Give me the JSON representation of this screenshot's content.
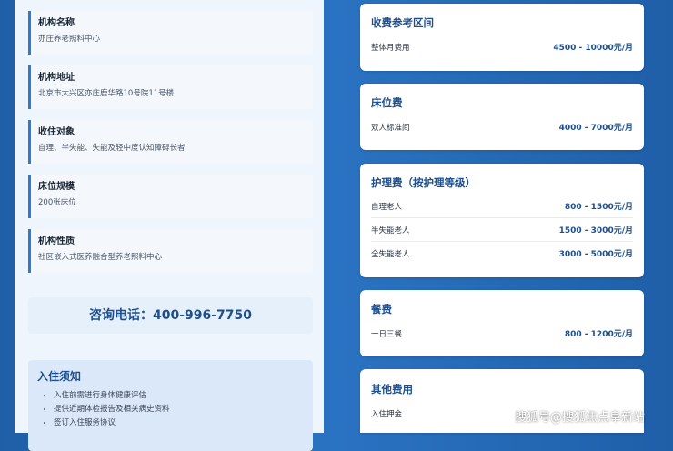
{
  "info_items": [
    {
      "title": "机构名称",
      "value": "亦庄养老照料中心"
    },
    {
      "title": "机构地址",
      "value": "北京市大兴区亦庄鹿华路10号院11号楼"
    },
    {
      "title": "收住对象",
      "value": "自理、半失能、失能及轻中度认知障碍长者"
    },
    {
      "title": "床位规模",
      "value": "200张床位"
    },
    {
      "title": "机构性质",
      "value": "社区嵌入式医养融合型养老照料中心"
    }
  ],
  "phone": "咨询电话：400-996-7750",
  "notice": {
    "title": "入住须知",
    "items": [
      "入住前需进行身体健康评估",
      "提供近期体检报告及相关病史资料",
      "签订入住服务协议"
    ]
  },
  "cards": [
    {
      "title": "收费参考区间",
      "rows": [
        {
          "label": "整体月费用",
          "price": "4500 - 10000元/月"
        }
      ]
    },
    {
      "title": "床位费",
      "rows": [
        {
          "label": "双人标准间",
          "price": "4000 - 7000元/月"
        }
      ]
    },
    {
      "title": "护理费（按护理等级）",
      "rows": [
        {
          "label": "自理老人",
          "price": "800 - 1500元/月"
        },
        {
          "label": "半失能老人",
          "price": "1500 - 3000元/月"
        },
        {
          "label": "全失能老人",
          "price": "3000 - 5000元/月"
        }
      ]
    },
    {
      "title": "餐费",
      "rows": [
        {
          "label": "一日三餐",
          "price": "800 - 1200元/月"
        }
      ]
    },
    {
      "title": "其他费用",
      "rows": [
        {
          "label": "入住押金",
          "price": ""
        }
      ]
    }
  ],
  "watermark": "搜狐号@搜狐焦点阜新站"
}
